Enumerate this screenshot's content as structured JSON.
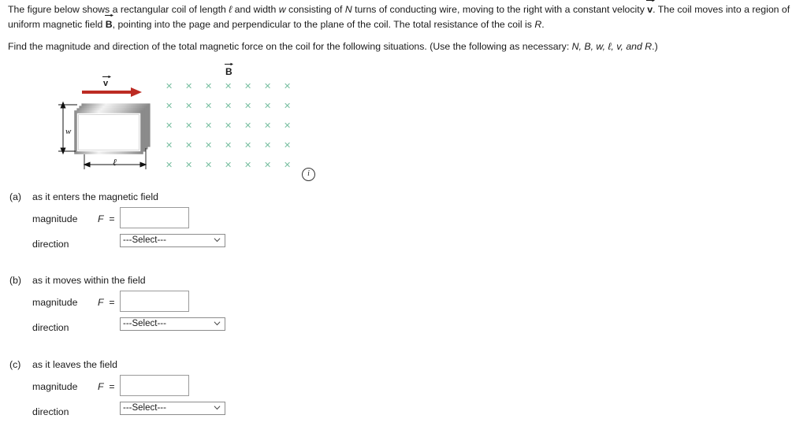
{
  "problem": {
    "paragraph1_part1": "The figure below shows a rectangular coil of length ",
    "symbol_l": "ℓ",
    "paragraph1_part2": " and width ",
    "symbol_w": "w",
    "paragraph1_part3": " consisting of ",
    "symbol_N": "N",
    "paragraph1_part4": " turns of conducting wire, moving to the right with a constant velocity ",
    "symbol_v_vec": "v",
    "paragraph1_part5": ". The coil moves into a region of uniform magnetic field ",
    "symbol_B_vec": "B",
    "paragraph1_part6": ", pointing into the page and perpendicular to the plane of the coil. The total resistance of the coil is ",
    "symbol_R": "R",
    "paragraph1_part7": ".",
    "paragraph2_part1": "Find the magnitude and direction of the total magnetic force on the coil for the following situations. (Use the following as necessary: ",
    "paragraph2_vars": "N, B, w, ℓ, v, and R",
    "paragraph2_part2": ".)"
  },
  "figure": {
    "b_field_label": "B",
    "velocity_label": "v",
    "width_label": "w",
    "length_label": "ℓ",
    "info_icon_label": "i",
    "field_marker": "✕",
    "field_marker_color": "#79bfa1",
    "velocity_arrow_color": "#bc2b23",
    "field_grid": {
      "columns": 7,
      "rows": 5,
      "col_spacing": 25,
      "row_spacing": 25
    },
    "coil_turns_drawn": 4
  },
  "parts": [
    {
      "letter": "(a)",
      "title": "as it enters the magnetic field",
      "magnitude_label": "magnitude",
      "f_equals": "F  =",
      "magnitude_value": "",
      "direction_label": "direction",
      "direction_selected": "---Select---",
      "direction_options": [
        "---Select---"
      ]
    },
    {
      "letter": "(b)",
      "title": "as it moves within the field",
      "magnitude_label": "magnitude",
      "f_equals": "F  =",
      "magnitude_value": "",
      "direction_label": "direction",
      "direction_selected": "---Select---",
      "direction_options": [
        "---Select---"
      ]
    },
    {
      "letter": "(c)",
      "title": "as it leaves the field",
      "magnitude_label": "magnitude",
      "f_equals": "F  =",
      "magnitude_value": "",
      "direction_label": "direction",
      "direction_selected": "---Select---",
      "direction_options": [
        "---Select---"
      ]
    }
  ]
}
